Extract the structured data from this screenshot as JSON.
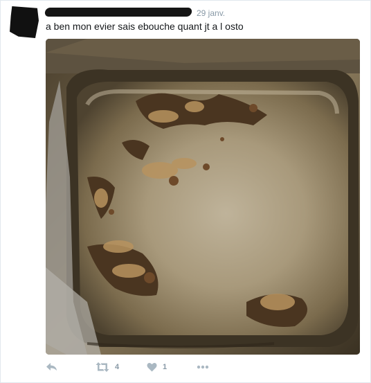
{
  "tweet": {
    "timestamp": "29 janv.",
    "text": "a ben mon evier sais ebouche quant jt a l osto",
    "media": {
      "description_icon": "photo"
    },
    "actions": {
      "reply_icon": "reply-icon",
      "retweet_icon": "retweet-icon",
      "retweet_count": "4",
      "like_icon": "heart-icon",
      "like_count": "1",
      "more_icon": "more-icon"
    }
  }
}
